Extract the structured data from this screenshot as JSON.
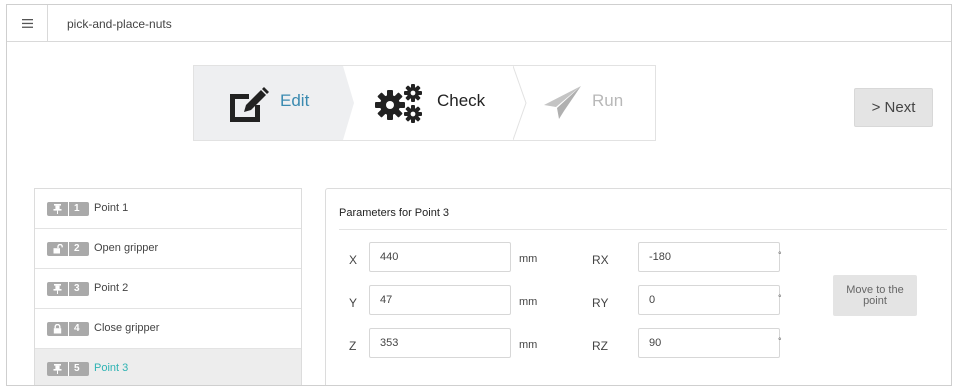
{
  "app": {
    "title": "pick-and-place-nuts",
    "menu_icon": "hamburger-icon"
  },
  "stepper": {
    "steps": [
      {
        "label": "Edit",
        "icon": "edit-icon",
        "state": "active",
        "color": "#3a8ab0"
      },
      {
        "label": "Check",
        "icon": "gears-icon",
        "state": "default",
        "color": "#222222"
      },
      {
        "label": "Run",
        "icon": "paper-plane-icon",
        "state": "disabled",
        "color": "#b8b8b8"
      }
    ],
    "next_label": "> Next"
  },
  "points": {
    "items": [
      {
        "index": "1",
        "label": "Point 1",
        "icon": "pin-icon"
      },
      {
        "index": "2",
        "label": "Open gripper",
        "icon": "unlock-icon"
      },
      {
        "index": "3",
        "label": "Point 2",
        "icon": "pin-icon"
      },
      {
        "index": "4",
        "label": "Close gripper",
        "icon": "lock-icon"
      },
      {
        "index": "5",
        "label": "Point 3",
        "icon": "pin-icon",
        "selected": true
      }
    ],
    "selected_color": "#2eb3b3"
  },
  "params": {
    "title": "Parameters for  Point 3",
    "x": {
      "label": "X",
      "value": "440",
      "unit": "mm"
    },
    "y": {
      "label": "Y",
      "value": "47",
      "unit": "mm"
    },
    "z": {
      "label": "Z",
      "value": "353",
      "unit": "mm"
    },
    "rx": {
      "label": "RX",
      "value": "-180",
      "unit": "°"
    },
    "ry": {
      "label": "RY",
      "value": "0",
      "unit": "°"
    },
    "rz": {
      "label": "RZ",
      "value": "90",
      "unit": "°"
    },
    "move_label": "Move to the point"
  }
}
